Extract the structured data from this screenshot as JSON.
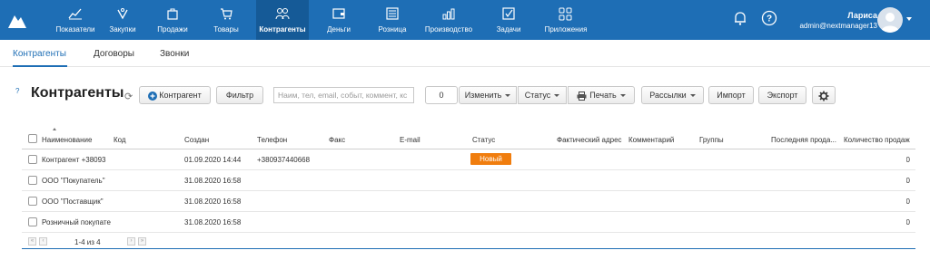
{
  "nav": {
    "items": [
      {
        "label": "Показатели",
        "icon": "chart-icon"
      },
      {
        "label": "Закупки",
        "icon": "box-icon"
      },
      {
        "label": "Продажи",
        "icon": "bag-icon"
      },
      {
        "label": "Товары",
        "icon": "cart-icon"
      },
      {
        "label": "Контрагенты",
        "icon": "people-icon",
        "active": true
      },
      {
        "label": "Деньги",
        "icon": "wallet-icon"
      },
      {
        "label": "Розница",
        "icon": "register-icon"
      },
      {
        "label": "Производство",
        "icon": "factory-icon"
      },
      {
        "label": "Задачи",
        "icon": "checkbox-icon"
      },
      {
        "label": "Приложения",
        "icon": "apps-icon"
      }
    ],
    "user_name": "Лариса",
    "user_email": "admin@nextmanager13"
  },
  "subtabs": [
    "Контрагенты",
    "Договоры",
    "Звонки"
  ],
  "toolbar": {
    "help": "?",
    "title": "Контрагенты",
    "add_label": "Контрагент",
    "filter_label": "Фильтр",
    "search_placeholder": "Наим, тел, email, событ, коммент, кс",
    "count": "0",
    "edit_label": "Изменить",
    "status_label": "Статус",
    "print_label": "Печать",
    "mailing_label": "Рассылки",
    "import_label": "Импорт",
    "export_label": "Экспорт"
  },
  "table": {
    "headers": [
      "Наименование",
      "Код",
      "Создан",
      "Телефон",
      "Факс",
      "E-mail",
      "Статус",
      "Фактический адрес",
      "Комментарий",
      "Группы",
      "Последняя прода...",
      "Количество продаж"
    ],
    "rows": [
      {
        "name": "Контрагент +38093",
        "created": "01.09.2020 14:44",
        "phone": "+380937440668",
        "status": "Новый",
        "sales": "0"
      },
      {
        "name": "ООО \"Покупатель\"",
        "created": "31.08.2020 16:58",
        "phone": "",
        "status": "",
        "sales": "0"
      },
      {
        "name": "ООО \"Поставщик\"",
        "created": "31.08.2020 16:58",
        "phone": "",
        "status": "",
        "sales": "0"
      },
      {
        "name": "Розничный покупате",
        "created": "31.08.2020 16:58",
        "phone": "",
        "status": "",
        "sales": "0"
      }
    ]
  },
  "pager": {
    "text": "1-4 из 4"
  },
  "colors": {
    "primary": "#1e6eb5",
    "active_nav": "#155a97",
    "status_new": "#f07d0e"
  }
}
